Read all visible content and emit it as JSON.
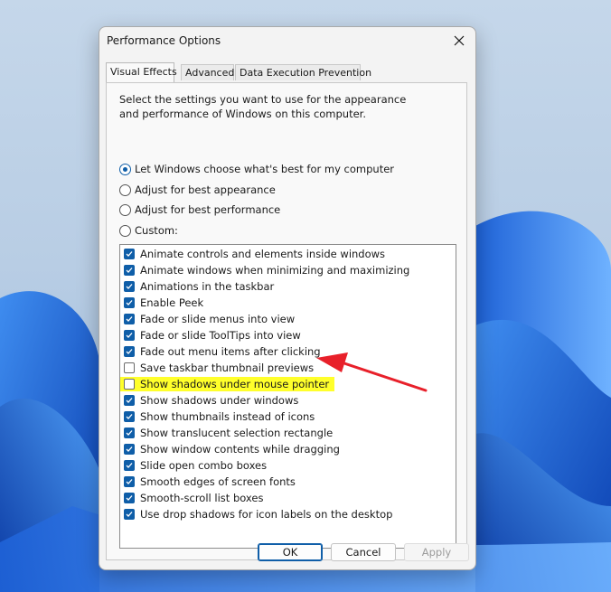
{
  "window": {
    "title": "Performance Options"
  },
  "tabs": [
    {
      "label": "Visual Effects",
      "active": true
    },
    {
      "label": "Advanced",
      "active": false
    },
    {
      "label": "Data Execution Prevention",
      "active": false
    }
  ],
  "visual_effects": {
    "description": "Select the settings you want to use for the appearance and performance of Windows on this computer.",
    "radio_options": [
      {
        "label": "Let Windows choose what's best for my computer",
        "selected": true
      },
      {
        "label": "Adjust for best appearance",
        "selected": false
      },
      {
        "label": "Adjust for best performance",
        "selected": false
      },
      {
        "label": "Custom:",
        "selected": false
      }
    ],
    "settings": [
      {
        "label": "Animate controls and elements inside windows",
        "checked": true
      },
      {
        "label": "Animate windows when minimizing and maximizing",
        "checked": true
      },
      {
        "label": "Animations in the taskbar",
        "checked": true
      },
      {
        "label": "Enable Peek",
        "checked": true
      },
      {
        "label": "Fade or slide menus into view",
        "checked": true
      },
      {
        "label": "Fade or slide ToolTips into view",
        "checked": true
      },
      {
        "label": "Fade out menu items after clicking",
        "checked": true
      },
      {
        "label": "Save taskbar thumbnail previews",
        "checked": false
      },
      {
        "label": "Show shadows under mouse pointer",
        "checked": false
      },
      {
        "label": "Show shadows under windows",
        "checked": true
      },
      {
        "label": "Show thumbnails instead of icons",
        "checked": true
      },
      {
        "label": "Show translucent selection rectangle",
        "checked": true
      },
      {
        "label": "Show window contents while dragging",
        "checked": true
      },
      {
        "label": "Slide open combo boxes",
        "checked": true
      },
      {
        "label": "Smooth edges of screen fonts",
        "checked": true
      },
      {
        "label": "Smooth-scroll list boxes",
        "checked": true
      },
      {
        "label": "Use drop shadows for icon labels on the desktop",
        "checked": true
      }
    ]
  },
  "buttons": {
    "ok": "OK",
    "cancel": "Cancel",
    "apply": "Apply"
  },
  "colors": {
    "accent": "#0f5ea8",
    "highlight": "#ffff2b",
    "annotation_arrow": "#e8202a"
  }
}
